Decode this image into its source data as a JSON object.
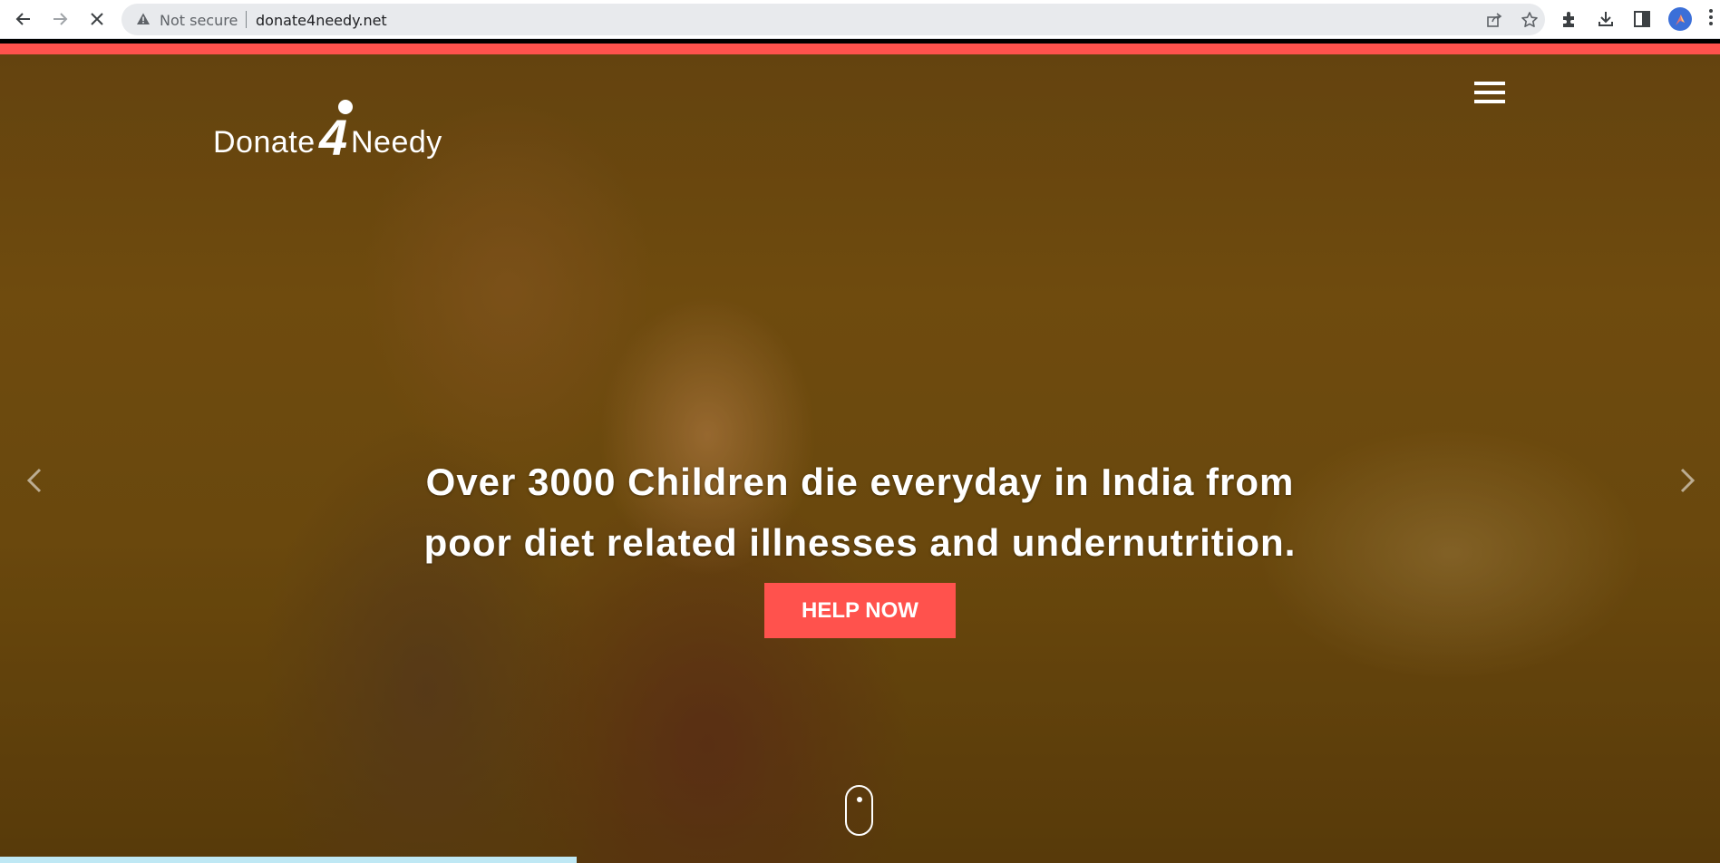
{
  "browser": {
    "security_label": "Not secure",
    "url": "donate4needy.net"
  },
  "site": {
    "logo": {
      "part1": "Donate",
      "part2": "4",
      "part3": "Needy"
    },
    "hero": {
      "headline_line1": "Over 3000 Children die everyday in India from",
      "headline_line2": "poor diet related illnesses and undernutrition.",
      "cta_label": "HELP NOW"
    }
  },
  "colors": {
    "accent": "#ff524d",
    "page_load_bar": "#bfe8f4"
  },
  "icons": {
    "back": "arrow-left-icon",
    "forward": "arrow-right-icon",
    "stop": "close-icon",
    "warning": "warning-triangle-icon",
    "share": "share-icon",
    "bookmark": "star-icon",
    "extensions": "puzzle-icon",
    "download": "download-icon",
    "side_panel": "side-panel-icon",
    "profile": "profile-avatar",
    "menu": "hamburger-icon",
    "prev": "chevron-left-icon",
    "next": "chevron-right-icon",
    "scroll": "mouse-scroll-icon"
  }
}
